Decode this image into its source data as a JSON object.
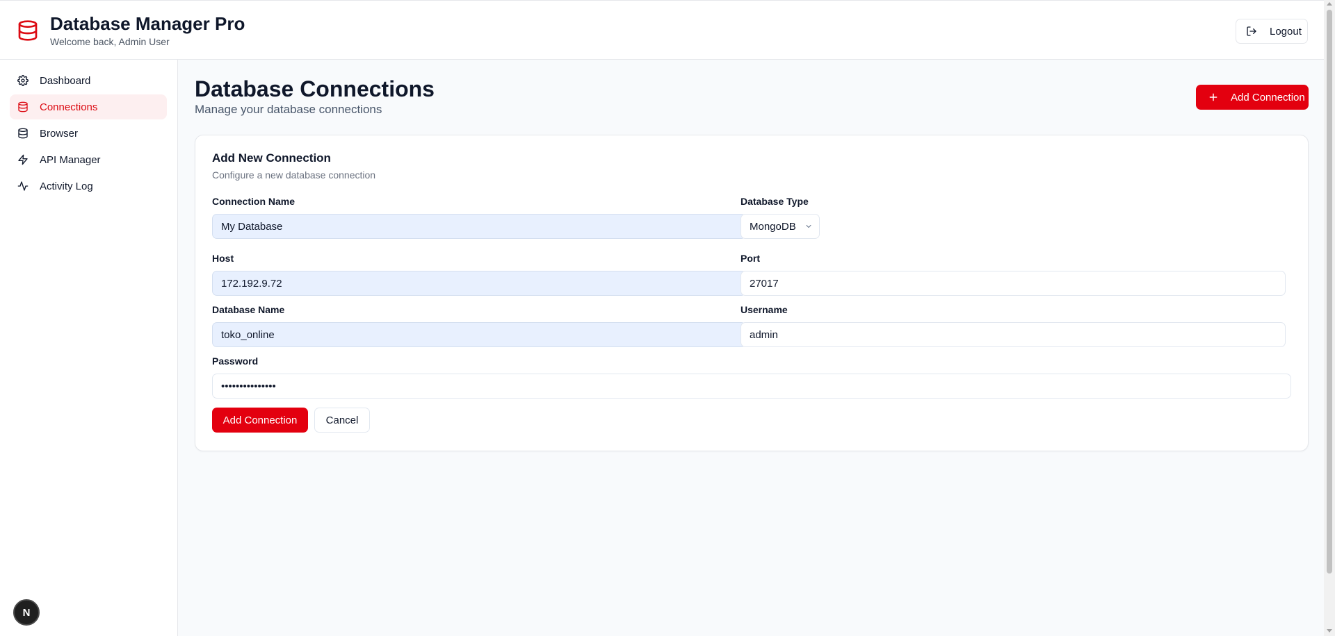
{
  "header": {
    "title": "Database Manager Pro",
    "subtitle": "Welcome back, Admin User",
    "logout_label": "Logout",
    "logo_icon": "database-icon"
  },
  "sidebar": {
    "items": [
      {
        "label": "Dashboard",
        "icon": "gear-icon",
        "active": false
      },
      {
        "label": "Connections",
        "icon": "database-icon",
        "active": true
      },
      {
        "label": "Browser",
        "icon": "database-icon",
        "active": false
      },
      {
        "label": "API Manager",
        "icon": "lightning-icon",
        "active": false
      },
      {
        "label": "Activity Log",
        "icon": "activity-icon",
        "active": false
      }
    ]
  },
  "main": {
    "title": "Database Connections",
    "subtitle": "Manage your database connections",
    "add_button_label": "Add Connection"
  },
  "form": {
    "title": "Add New Connection",
    "subtitle": "Configure a new database connection",
    "fields": {
      "connection_name": {
        "label": "Connection Name",
        "value": "My Database"
      },
      "database_type": {
        "label": "Database Type",
        "value": "MongoDB"
      },
      "host": {
        "label": "Host",
        "value": "172.192.9.72"
      },
      "port": {
        "label": "Port",
        "value": "27017"
      },
      "database_name": {
        "label": "Database Name",
        "value": "toko_online"
      },
      "username": {
        "label": "Username",
        "value": "admin"
      },
      "password": {
        "label": "Password",
        "value": "•••••••••••••••"
      }
    },
    "submit_label": "Add Connection",
    "cancel_label": "Cancel"
  },
  "badge": {
    "label": "N"
  },
  "colors": {
    "accent": "#e3000f",
    "active_bg": "#fdeff0",
    "active_text": "#dc0a12",
    "autofill_bg": "#e8f0fe"
  }
}
